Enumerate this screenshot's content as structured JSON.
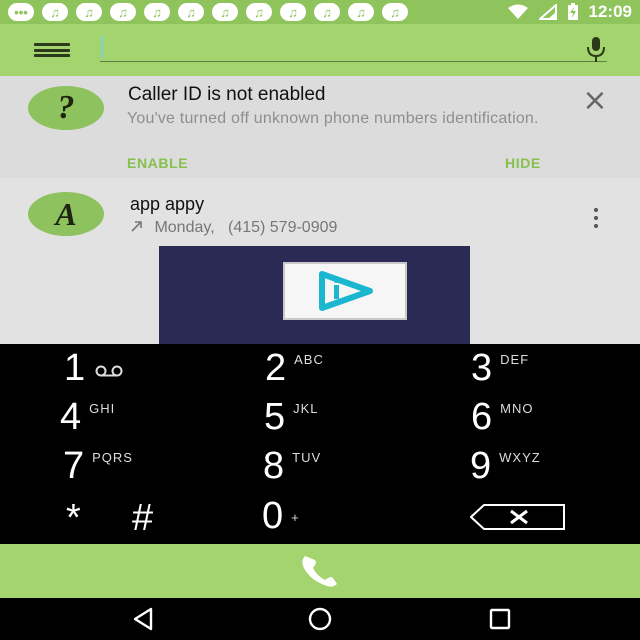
{
  "status_bar": {
    "notification_icons": [
      "♫",
      "♫",
      "♫",
      "♫",
      "♫",
      "♫",
      "♫",
      "♫",
      "♫",
      "♫",
      "♫",
      "♫"
    ],
    "time": "12:09",
    "icons": [
      "overflow-dots-icon",
      "music-note-icon",
      "wifi-icon",
      "signal-icon",
      "battery-charging-icon"
    ]
  },
  "search": {
    "placeholder": "",
    "value": ""
  },
  "caller_id_card": {
    "avatar": "?",
    "title": "Caller ID is not enabled",
    "message": "You've turned off unknown phone numbers identification.",
    "enable_label": "ENABLE",
    "hide_label": "HIDE"
  },
  "recent_call": {
    "avatar": "A",
    "name": "app appy",
    "direction_icon": "outgoing-call-arrow-icon",
    "day": "Monday,",
    "number": "(415) 579-0909"
  },
  "dialpad": {
    "keys": [
      {
        "digit": "1",
        "letters": ""
      },
      {
        "digit": "2",
        "letters": "ABC"
      },
      {
        "digit": "3",
        "letters": "DEF"
      },
      {
        "digit": "4",
        "letters": "GHI"
      },
      {
        "digit": "5",
        "letters": "JKL"
      },
      {
        "digit": "6",
        "letters": "MNO"
      },
      {
        "digit": "7",
        "letters": "PQRS"
      },
      {
        "digit": "8",
        "letters": "TUV"
      },
      {
        "digit": "9",
        "letters": "WXYZ"
      },
      {
        "digit": "*",
        "letters": ""
      },
      {
        "digit": "#",
        "letters": ""
      },
      {
        "digit": "0",
        "letters": "+"
      }
    ]
  },
  "colors": {
    "accent_green": "#a3d46d",
    "status_green": "#8fc35c",
    "action_green": "#86c04f"
  }
}
